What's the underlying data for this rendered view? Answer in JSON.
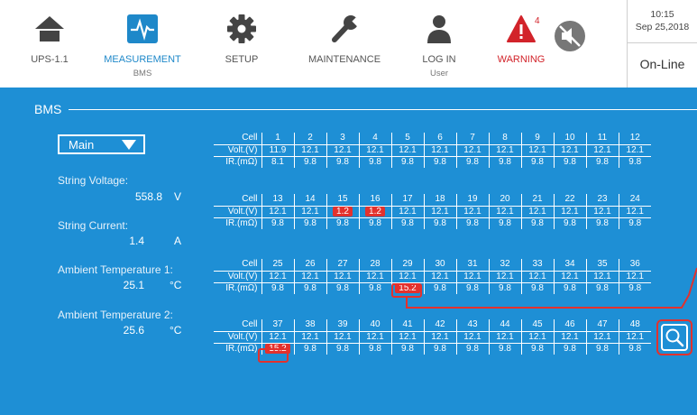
{
  "nav": {
    "ups": {
      "label": "UPS-1.1"
    },
    "measurement": {
      "label": "MEASUREMENT",
      "sub": "BMS"
    },
    "setup": {
      "label": "SETUP"
    },
    "maintenance": {
      "label": "MAINTENANCE"
    },
    "login": {
      "label": "LOG IN",
      "sub": "User"
    },
    "warning": {
      "label": "WARNING",
      "count": "4"
    }
  },
  "clock": {
    "time": "10:15",
    "date": "Sep 25,2018"
  },
  "status": "On-Line",
  "section_title": "BMS",
  "selector": {
    "value": "Main"
  },
  "measurements": [
    {
      "label": "String Voltage:",
      "value": "558.8",
      "unit": "V"
    },
    {
      "label": "String Current:",
      "value": "1.4",
      "unit": "A"
    },
    {
      "label": "Ambient Temperature 1:",
      "value": "25.1",
      "unit": "°C"
    },
    {
      "label": "Ambient Temperature 2:",
      "value": "25.6",
      "unit": "°C"
    }
  ],
  "row_labels": {
    "cell": "Cell",
    "volt": "Volt.(V)",
    "ir": "IR.(mΩ)"
  },
  "tables": [
    {
      "cells": [
        "1",
        "2",
        "3",
        "4",
        "5",
        "6",
        "7",
        "8",
        "9",
        "10",
        "11",
        "12"
      ],
      "volt": [
        "11.9",
        "12.1",
        "12.1",
        "12.1",
        "12.1",
        "12.1",
        "12.1",
        "12.1",
        "12.1",
        "12.1",
        "12.1",
        "12.1"
      ],
      "ir": [
        "8.1",
        "9.8",
        "9.8",
        "9.8",
        "9.8",
        "9.8",
        "9.8",
        "9.8",
        "9.8",
        "9.8",
        "9.8",
        "9.8"
      ],
      "volt_alarm": [],
      "ir_alarm": []
    },
    {
      "cells": [
        "13",
        "14",
        "15",
        "16",
        "17",
        "18",
        "19",
        "20",
        "21",
        "22",
        "23",
        "24"
      ],
      "volt": [
        "12.1",
        "12.1",
        "1.2",
        "1.2",
        "12.1",
        "12.1",
        "12.1",
        "12.1",
        "12.1",
        "12.1",
        "12.1",
        "12.1"
      ],
      "ir": [
        "9.8",
        "9.8",
        "9.8",
        "9.8",
        "9.8",
        "9.8",
        "9.8",
        "9.8",
        "9.8",
        "9.8",
        "9.8",
        "9.8"
      ],
      "volt_alarm": [
        2,
        3
      ],
      "ir_alarm": []
    },
    {
      "cells": [
        "25",
        "26",
        "27",
        "28",
        "29",
        "30",
        "31",
        "32",
        "33",
        "34",
        "35",
        "36"
      ],
      "volt": [
        "12.1",
        "12.1",
        "12.1",
        "12.1",
        "12.1",
        "12.1",
        "12.1",
        "12.1",
        "12.1",
        "12.1",
        "12.1",
        "12.1"
      ],
      "ir": [
        "9.8",
        "9.8",
        "9.8",
        "9.8",
        "15.2",
        "9.8",
        "9.8",
        "9.8",
        "9.8",
        "9.8",
        "9.8",
        "9.8"
      ],
      "volt_alarm": [],
      "ir_alarm": [
        4
      ]
    },
    {
      "cells": [
        "37",
        "38",
        "39",
        "40",
        "41",
        "42",
        "43",
        "44",
        "45",
        "46",
        "47",
        "48"
      ],
      "volt": [
        "12.1",
        "12.1",
        "12.1",
        "12.1",
        "12.1",
        "12.1",
        "12.1",
        "12.1",
        "12.1",
        "12.1",
        "12.1",
        "12.1"
      ],
      "ir": [
        "15.2",
        "9.8",
        "9.8",
        "9.8",
        "9.8",
        "9.8",
        "9.8",
        "9.8",
        "9.8",
        "9.8",
        "9.8",
        "9.8"
      ],
      "volt_alarm": [],
      "ir_alarm": [
        0
      ]
    }
  ],
  "icons": {
    "ups": "home-icon",
    "measurement": "pulse-icon",
    "setup": "gear-icon",
    "maintenance": "wrench-icon",
    "login": "user-icon",
    "warning": "warning-icon",
    "mute": "mute-icon",
    "zoom": "search-icon"
  },
  "colors": {
    "accent": "#1e88c9",
    "panel": "#1e8fd5",
    "alarm": "#e3312d"
  }
}
